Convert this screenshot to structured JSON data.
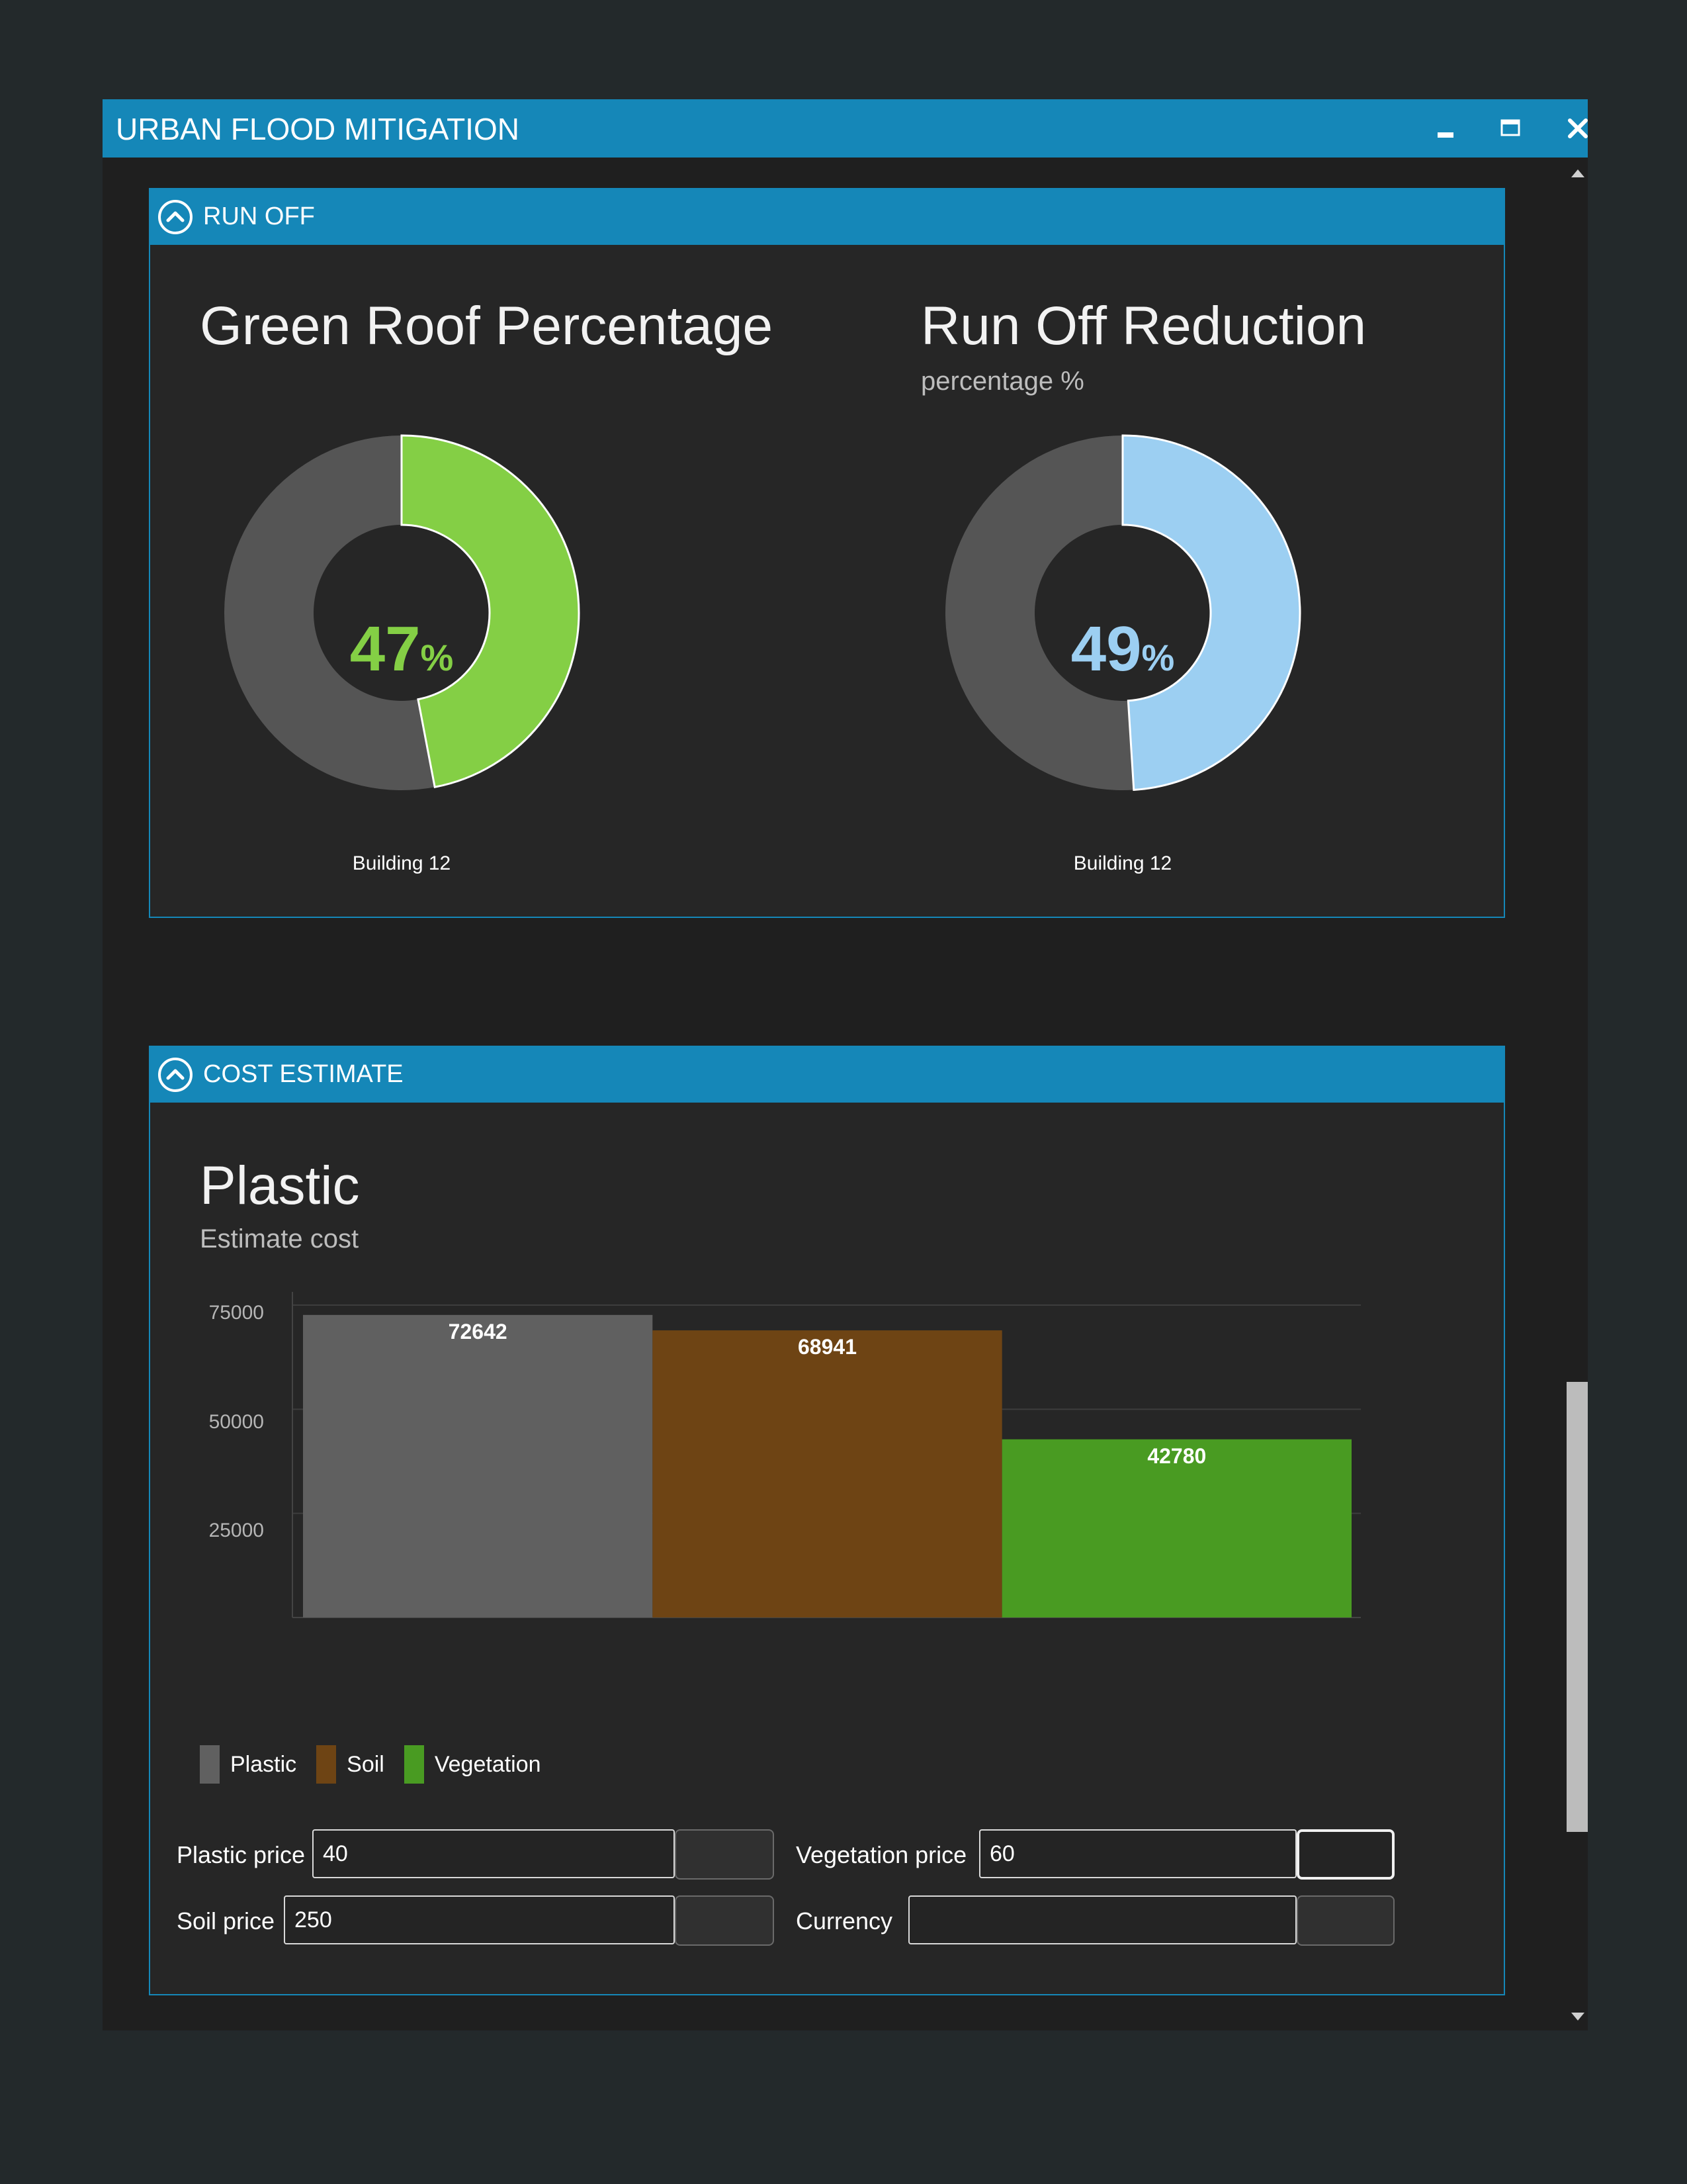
{
  "window": {
    "title": "URBAN FLOOD MITIGATION",
    "minimize_icon": "minimize-icon",
    "maximize_icon": "maximize-icon",
    "close_icon": "close-icon"
  },
  "runoff_section": {
    "header": "RUN OFF",
    "collapse_icon": "chevron-up-circle-icon",
    "green_roof": {
      "title": "Green Roof Percentage",
      "value": "47",
      "unit": "%",
      "fraction": 0.47,
      "label": "Building 12",
      "color": "#84cf45"
    },
    "runoff_reduction": {
      "title": "Run Off Reduction",
      "subtitle": "percentage %",
      "value": "49",
      "unit": "%",
      "fraction": 0.49,
      "label": "Building 12",
      "color": "#9ccff2"
    }
  },
  "cost_section": {
    "header": "COST ESTIMATE",
    "collapse_icon": "chevron-up-circle-icon",
    "chart_title": "Plastic",
    "chart_subtitle": "Estimate cost",
    "chart_data": {
      "type": "bar",
      "title": "Plastic",
      "subtitle": "Estimate cost",
      "categories": [
        "Plastic",
        "Soil",
        "Vegetation"
      ],
      "values": [
        72642,
        68941,
        42780
      ],
      "data_labels": [
        "72642",
        "68941",
        "42780"
      ],
      "colors": [
        "#606060",
        "#6e4414",
        "#499b22"
      ],
      "y_ticks": [
        "75000",
        "50000",
        "25000"
      ],
      "ylim": [
        0,
        75000
      ],
      "grid": true,
      "legend_position": "bottom-left"
    },
    "fields": {
      "plastic_price": {
        "label": "Plastic price",
        "value": "40"
      },
      "soil_price": {
        "label": "Soil price",
        "value": "250"
      },
      "vegetation_price": {
        "label": "Vegetation price",
        "value": "60"
      },
      "currency": {
        "label": "Currency",
        "value": ""
      }
    }
  },
  "scrollbar": {
    "up_icon": "scroll-up-arrow-icon",
    "down_icon": "scroll-down-arrow-icon"
  }
}
